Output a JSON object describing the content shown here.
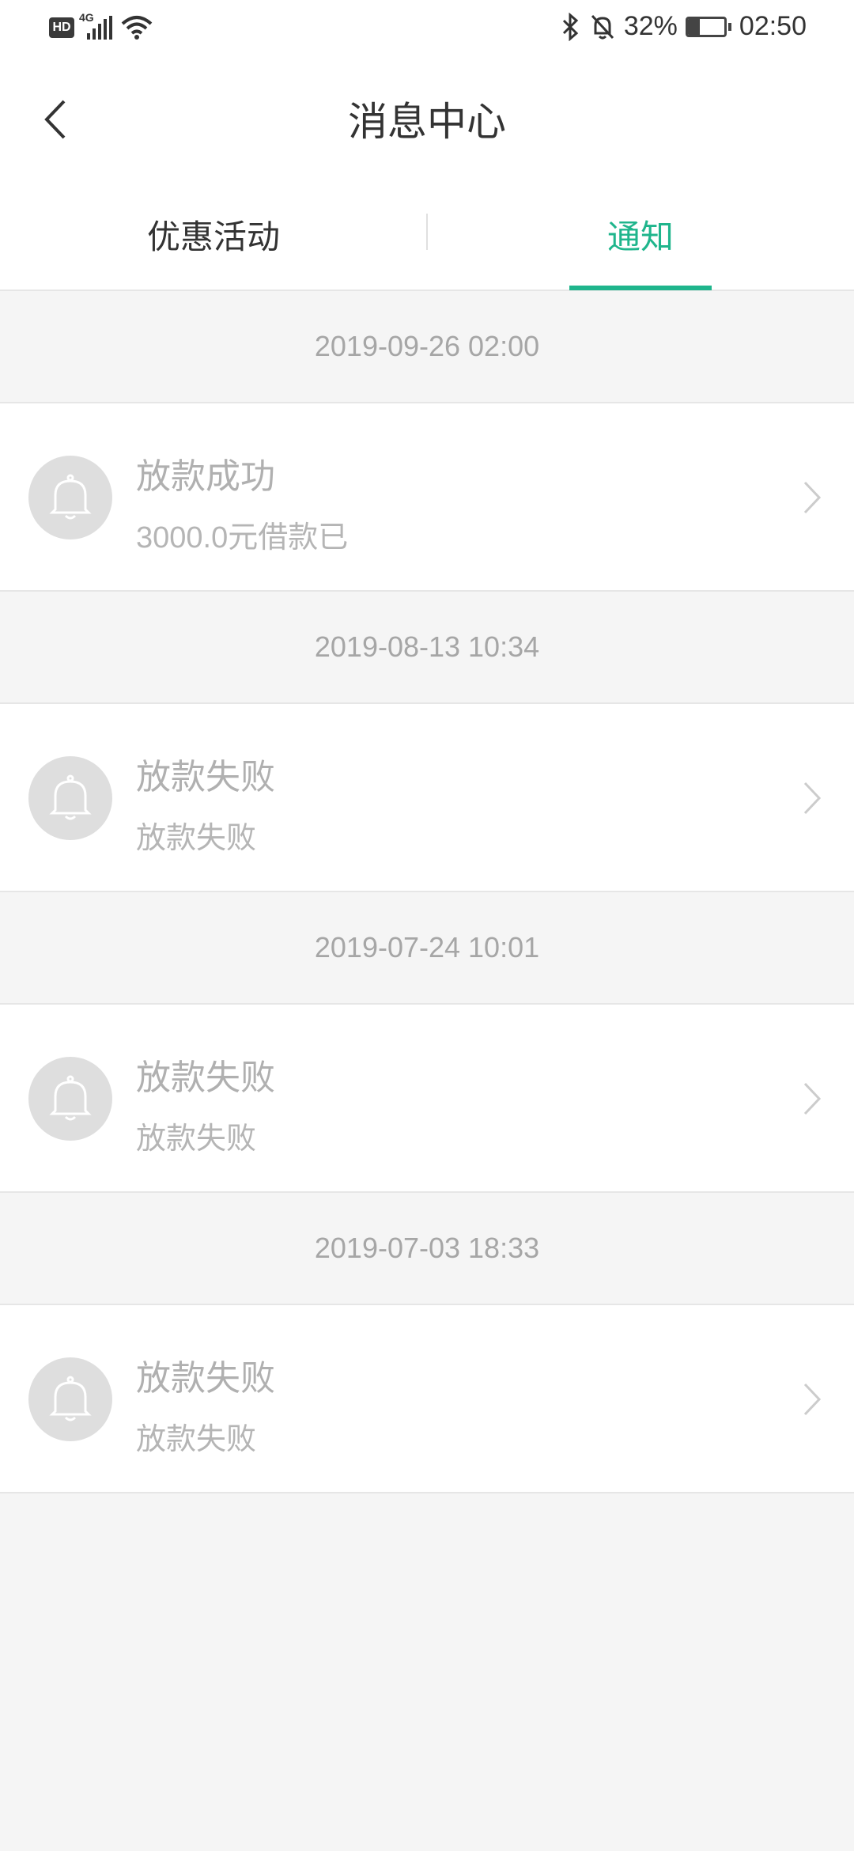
{
  "status_bar": {
    "hd_badge": "HD",
    "network": "4G",
    "battery_percent": "32%",
    "battery_level": 0.32,
    "time": "02:50",
    "icons": [
      "hd-icon",
      "signal-icon",
      "wifi-icon",
      "bluetooth-icon",
      "mute-bell-icon",
      "battery-icon"
    ]
  },
  "header": {
    "title": "消息中心",
    "back_icon": "chevron-left-icon"
  },
  "tabs": {
    "items": [
      {
        "label": "优惠活动",
        "active": false
      },
      {
        "label": "通知",
        "active": true
      }
    ]
  },
  "colors": {
    "accent": "#1fb58c",
    "background": "#f5f5f5",
    "card": "#ffffff",
    "muted_text": "#b0b0b0",
    "date_text": "#a6a6a6"
  },
  "messages": [
    {
      "date": "2019-09-26 02:00",
      "title": "放款成功",
      "body": "3000.0元借款已",
      "icon": "bell-icon"
    },
    {
      "date": "2019-08-13 10:34",
      "title": "放款失败",
      "body": "放款失败",
      "icon": "bell-icon"
    },
    {
      "date": "2019-07-24 10:01",
      "title": "放款失败",
      "body": "放款失败",
      "icon": "bell-icon"
    },
    {
      "date": "2019-07-03 18:33",
      "title": "放款失败",
      "body": "放款失败",
      "icon": "bell-icon"
    }
  ]
}
